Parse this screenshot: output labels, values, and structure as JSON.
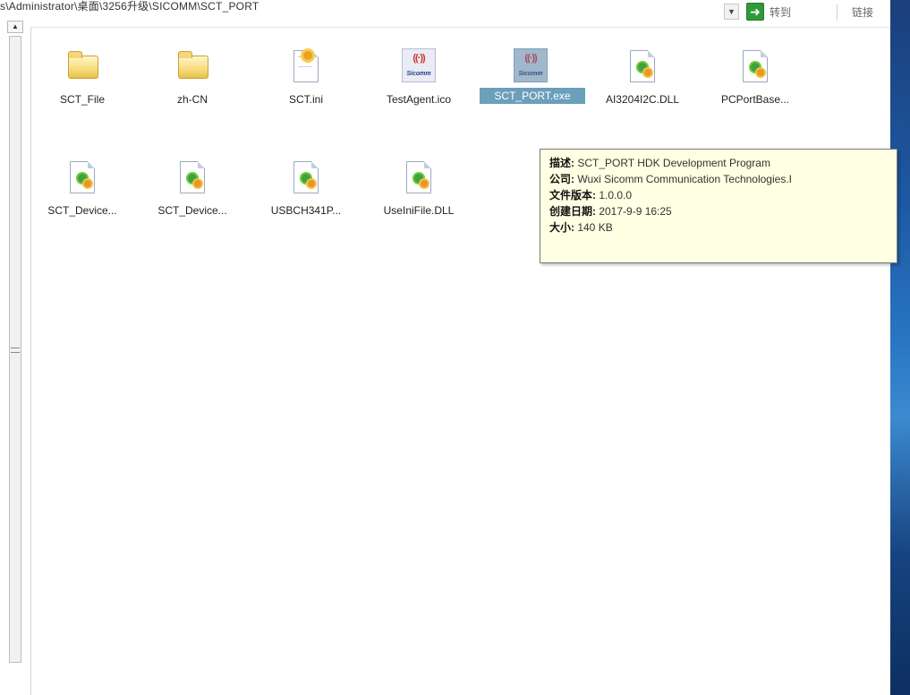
{
  "address_bar": {
    "path": "s\\Administrator\\桌面\\3256升级\\SICOMM\\SCT_PORT",
    "dropdown_glyph": "▼",
    "go_glyph": "➜",
    "go_label": "转到",
    "links_label": "链接"
  },
  "sidebar": {
    "scroll_up_glyph": "▲"
  },
  "files": [
    {
      "name": "SCT_File",
      "icon": "folder-icon"
    },
    {
      "name": "zh-CN",
      "icon": "folder-icon"
    },
    {
      "name": "SCT.ini",
      "icon": "ini-file-icon"
    },
    {
      "name": "TestAgent.ico",
      "icon": "sicomm-icon"
    },
    {
      "name": "SCT_PORT.exe",
      "icon": "sicomm-icon",
      "selected": true
    },
    {
      "name": "AI3204I2C.DLL",
      "icon": "dll-file-icon"
    },
    {
      "name": "PCPortBase...",
      "icon": "dll-file-icon"
    },
    {
      "name": "SCT_Device...",
      "icon": "dll-file-icon"
    },
    {
      "name": "SCT_Device...",
      "icon": "dll-file-icon"
    },
    {
      "name": "USBCH341P...",
      "icon": "dll-file-icon"
    },
    {
      "name": "UseIniFile.DLL",
      "icon": "dll-file-icon"
    }
  ],
  "sicomm_brand": "Sicomm",
  "sicomm_waves": "((·))",
  "tooltip": {
    "description_key": "描述:",
    "description_val": " SCT_PORT HDK Development Program",
    "company_key": "公司:",
    "company_val": " Wuxi Sicomm Communication Technologies.I",
    "version_key": "文件版本:",
    "version_val": " 1.0.0.0",
    "created_key": "创建日期:",
    "created_val": " 2017-9-9 16:25",
    "size_key": "大小:",
    "size_val": " 140 KB"
  },
  "colors": {
    "selection": "#6b9fba",
    "tooltip_bg": "#ffffe3",
    "go_button": "#2e9a3a"
  }
}
